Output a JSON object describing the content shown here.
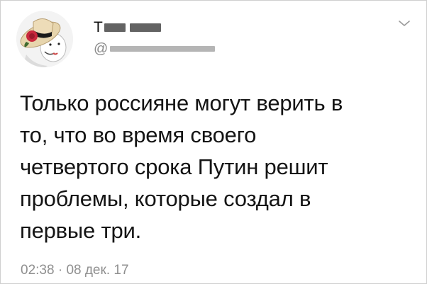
{
  "tweet": {
    "author": {
      "name_visible_initial": "Т",
      "handle_prefix": "@"
    },
    "body_lines": [
      "Только россияне могут верить в",
      "то, что во время своего",
      "четвертого срока Путин решит",
      "проблемы, которые создал в",
      "первые три."
    ],
    "time": "02:38",
    "separator": "·",
    "date": "08 дек. 17",
    "menu_icon": "chevron-down-icon",
    "avatar_icon": "avatar-hat-rose-icon"
  },
  "colors": {
    "text": "#141414",
    "muted": "#8f8f8f",
    "border": "#cfcfcf",
    "avatar_hat": "#e7d5ad",
    "avatar_band": "#1a1a1a",
    "avatar_rose": "#c8283c"
  }
}
